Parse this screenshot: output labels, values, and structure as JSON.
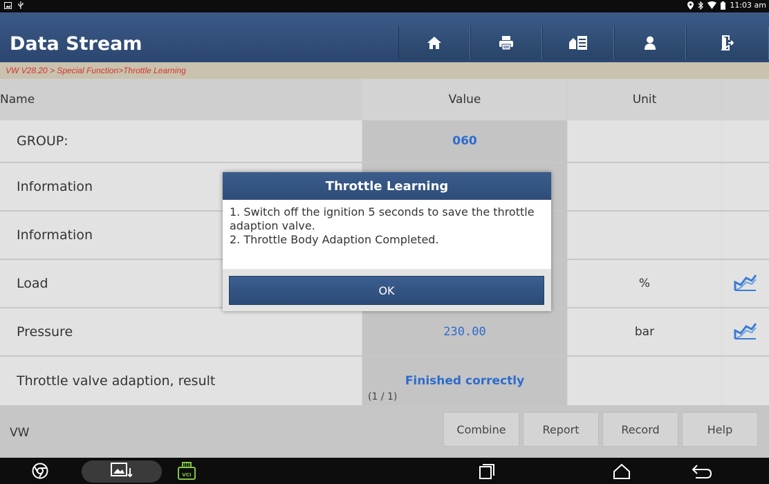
{
  "status_bar": {
    "time": "11:03 am",
    "left_icons": [
      "image-notification-icon",
      "usb-icon"
    ],
    "right_icons": [
      "location-icon",
      "bluetooth-icon",
      "wifi-icon",
      "battery-icon"
    ]
  },
  "header": {
    "title": "Data Stream",
    "toolbar": [
      {
        "name": "home-button",
        "icon": "home-icon"
      },
      {
        "name": "print-button",
        "icon": "printer-icon"
      },
      {
        "name": "report-button",
        "icon": "report-icon"
      },
      {
        "name": "user-button",
        "icon": "user-icon"
      },
      {
        "name": "exit-button",
        "icon": "exit-icon"
      }
    ]
  },
  "breadcrumb": "VW V28.20 > Special Function>Throttle Learning",
  "table": {
    "columns": {
      "name": "Name",
      "value": "Value",
      "unit": "Unit"
    },
    "rows": [
      {
        "name": "GROUP:",
        "value": "060",
        "unit": "",
        "graph": false
      },
      {
        "name": "Information",
        "value": "",
        "unit": "",
        "graph": false
      },
      {
        "name": "Information",
        "value": "",
        "unit": "",
        "graph": false
      },
      {
        "name": "Load",
        "value": "",
        "unit": "%",
        "graph": true
      },
      {
        "name": "Pressure",
        "value": "230.00",
        "unit": "bar",
        "graph": true
      },
      {
        "name": "Throttle valve adaption, result",
        "value": "Finished correctly",
        "counter": "(1 / 1)",
        "unit": "",
        "graph": false
      }
    ]
  },
  "footer": {
    "brand": "VW",
    "buttons": {
      "combine": "Combine",
      "report": "Report",
      "record": "Record",
      "help": "Help"
    }
  },
  "dialog": {
    "title": "Throttle Learning",
    "line1": "1. Switch off the ignition 5 seconds to save the throttle adaption valve.",
    "line2": "2. Throttle Body Adaption Completed.",
    "ok": "OK"
  },
  "nav_bar": {
    "vci_label": "VCI",
    "icons": [
      "browser-icon",
      "gallery-icon",
      "vci-icon",
      "recent-apps-icon",
      "home-nav-icon",
      "back-icon"
    ]
  },
  "colors": {
    "header": "#2f4c75",
    "value_text": "#2d6ccc",
    "breadcrumb_text": "#d5332b",
    "graph_icon": "#3a7bd5"
  }
}
